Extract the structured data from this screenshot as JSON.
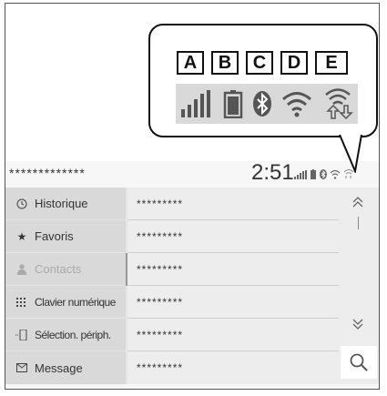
{
  "callout": {
    "labels": [
      "A",
      "B",
      "C",
      "D",
      "E"
    ],
    "icons": [
      "signal-bars-icon",
      "battery-icon",
      "bluetooth-icon",
      "wifi-icon",
      "wifi-data-icon"
    ]
  },
  "status": {
    "title": "*************",
    "clock": "2:51"
  },
  "menu": {
    "items": [
      {
        "label": "Historique",
        "icon": "clock-icon"
      },
      {
        "label": "Favoris",
        "icon": "star-icon"
      },
      {
        "label": "Contacts",
        "icon": "person-icon"
      },
      {
        "label": "Clavier numérique",
        "icon": "keypad-icon"
      },
      {
        "label": "Sélection. périph.",
        "icon": "phone-device-icon"
      },
      {
        "label": "Message",
        "icon": "envelope-icon"
      }
    ]
  },
  "rows": [
    "*********",
    "*********",
    "*********",
    "*********",
    "*********",
    "*********"
  ],
  "colors": {
    "panel": "#e6e6e6",
    "menu": "#d9d9d9",
    "active_text": "#aaaaaa"
  }
}
